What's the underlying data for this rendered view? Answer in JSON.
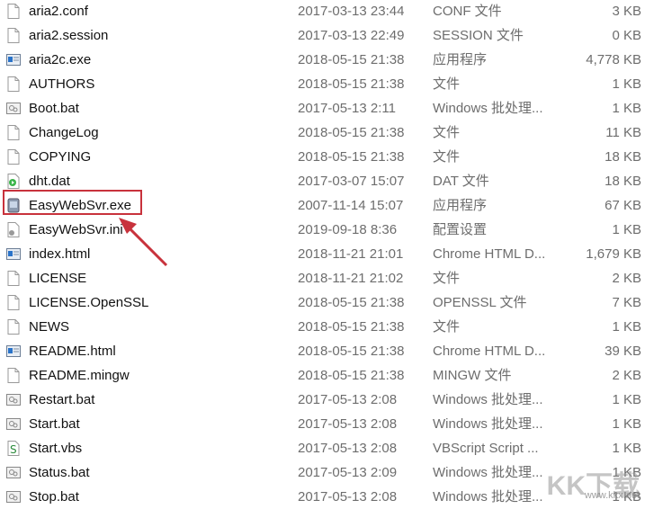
{
  "files": [
    {
      "name": "aria2.conf",
      "date": "2017-03-13 23:44",
      "type": "CONF 文件",
      "size": "3 KB",
      "icon": "blank-file"
    },
    {
      "name": "aria2.session",
      "date": "2017-03-13 22:49",
      "type": "SESSION 文件",
      "size": "0 KB",
      "icon": "blank-file"
    },
    {
      "name": "aria2c.exe",
      "date": "2018-05-15 21:38",
      "type": "应用程序",
      "size": "4,778 KB",
      "icon": "exe"
    },
    {
      "name": "AUTHORS",
      "date": "2018-05-15 21:38",
      "type": "文件",
      "size": "1 KB",
      "icon": "blank-file"
    },
    {
      "name": "Boot.bat",
      "date": "2017-05-13 2:11",
      "type": "Windows 批处理...",
      "size": "1 KB",
      "icon": "batch"
    },
    {
      "name": "ChangeLog",
      "date": "2018-05-15 21:38",
      "type": "文件",
      "size": "11 KB",
      "icon": "blank-file"
    },
    {
      "name": "COPYING",
      "date": "2018-05-15 21:38",
      "type": "文件",
      "size": "18 KB",
      "icon": "blank-file"
    },
    {
      "name": "dht.dat",
      "date": "2017-03-07 15:07",
      "type": "DAT 文件",
      "size": "18 KB",
      "icon": "media"
    },
    {
      "name": "EasyWebSvr.exe",
      "date": "2007-11-14 15:07",
      "type": "应用程序",
      "size": "67 KB",
      "icon": "server-exe"
    },
    {
      "name": "EasyWebSvr.ini",
      "date": "2019-09-18 8:36",
      "type": "配置设置",
      "size": "1 KB",
      "icon": "settings-file"
    },
    {
      "name": "index.html",
      "date": "2018-11-21 21:01",
      "type": "Chrome HTML D...",
      "size": "1,679 KB",
      "icon": "exe"
    },
    {
      "name": "LICENSE",
      "date": "2018-11-21 21:02",
      "type": "文件",
      "size": "2 KB",
      "icon": "blank-file"
    },
    {
      "name": "LICENSE.OpenSSL",
      "date": "2018-05-15 21:38",
      "type": "OPENSSL 文件",
      "size": "7 KB",
      "icon": "blank-file"
    },
    {
      "name": "NEWS",
      "date": "2018-05-15 21:38",
      "type": "文件",
      "size": "1 KB",
      "icon": "blank-file"
    },
    {
      "name": "README.html",
      "date": "2018-05-15 21:38",
      "type": "Chrome HTML D...",
      "size": "39 KB",
      "icon": "exe"
    },
    {
      "name": "README.mingw",
      "date": "2018-05-15 21:38",
      "type": "MINGW 文件",
      "size": "2 KB",
      "icon": "blank-file"
    },
    {
      "name": "Restart.bat",
      "date": "2017-05-13 2:08",
      "type": "Windows 批处理...",
      "size": "1 KB",
      "icon": "batch"
    },
    {
      "name": "Start.bat",
      "date": "2017-05-13 2:08",
      "type": "Windows 批处理...",
      "size": "1 KB",
      "icon": "batch"
    },
    {
      "name": "Start.vbs",
      "date": "2017-05-13 2:08",
      "type": "VBScript Script ...",
      "size": "1 KB",
      "icon": "script"
    },
    {
      "name": "Status.bat",
      "date": "2017-05-13 2:09",
      "type": "Windows 批处理...",
      "size": "1 KB",
      "icon": "batch"
    },
    {
      "name": "Stop.bat",
      "date": "2017-05-13 2:08",
      "type": "Windows 批处理...",
      "size": "1 KB",
      "icon": "batch"
    }
  ],
  "annotation": {
    "highlighted": "EasyWebSvr.exe",
    "color": "#c8323c"
  },
  "watermark": {
    "text": "KK下载",
    "url": "www.kkx.net"
  }
}
